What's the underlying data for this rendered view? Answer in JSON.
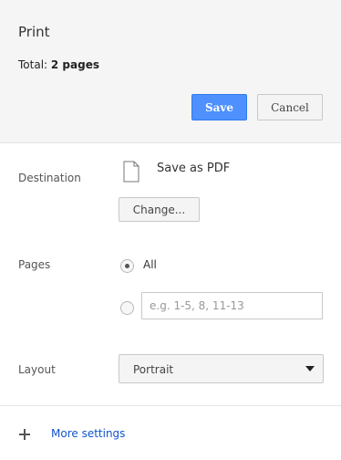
{
  "header": {
    "title": "Print",
    "total_label": "Total:",
    "total_value": "2 pages",
    "save_label": "Save",
    "cancel_label": "Cancel"
  },
  "destination": {
    "label": "Destination",
    "name": "Save as PDF",
    "change_label": "Change..."
  },
  "pages": {
    "label": "Pages",
    "all_label": "All",
    "selected": "All",
    "range_placeholder": "e.g. 1-5, 8, 11-13",
    "range_value": ""
  },
  "layout": {
    "label": "Layout",
    "selected": "Portrait"
  },
  "more_settings_label": "More settings",
  "colors": {
    "accent": "#4d90fe",
    "link": "#1155cc",
    "header_bg": "#f5f5f5"
  },
  "icons": {
    "destination": "document-icon",
    "more_settings": "plus-icon",
    "layout_select": "chevron-down-icon"
  }
}
